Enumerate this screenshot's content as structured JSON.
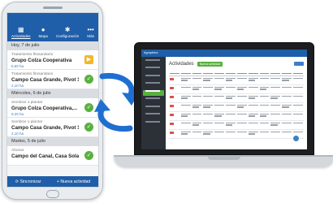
{
  "phone": {
    "nav": [
      {
        "label": "Actividades",
        "icon": "calendar-icon",
        "glyph": "▦",
        "active": true
      },
      {
        "label": "Mapa",
        "icon": "map-pin-icon",
        "glyph": "●",
        "active": false
      },
      {
        "label": "Configuración",
        "icon": "gear-icon",
        "glyph": "✱",
        "active": false
      },
      {
        "label": "Más",
        "icon": "more-icon",
        "glyph": "•••",
        "active": false
      }
    ],
    "days": [
      {
        "header": "Hoy, 7 de julio",
        "tasks": [
          {
            "type": "Tratamiento fitosanitario",
            "place": "Grupo Colza Cooperativa",
            "meta": "5,60 ha",
            "status": "play",
            "status_icon": "play-icon",
            "glyph": "▶"
          },
          {
            "type": "Tratamiento fitosanitario",
            "place": "Campo Casa Grande, Pivot 1",
            "meta": "2,10 ha",
            "status": "done",
            "status_icon": "check-icon",
            "glyph": "✓"
          }
        ]
      },
      {
        "header": "Miércoles, 6 de julio",
        "tasks": [
          {
            "type": "Sembrar o plantar",
            "place": "Grupo Colza Cooperativa,...",
            "meta": "9,20 ha",
            "status": "done",
            "status_icon": "check-icon",
            "glyph": "✓"
          },
          {
            "type": "Sembrar o plantar",
            "place": "Campo Casa Grande, Pivot 1",
            "meta": "2,10 ha",
            "status": "done",
            "status_icon": "check-icon",
            "glyph": "✓"
          }
        ]
      },
      {
        "header": "Martes, 5 de julio",
        "tasks": [
          {
            "type": "Abonar",
            "place": "Campo del Canal, Casa Solana",
            "meta": "",
            "status": "done",
            "status_icon": "check-icon",
            "glyph": "✓"
          }
        ]
      }
    ],
    "footer": {
      "sync": "Sincronizar",
      "new_activity": "+ Nueva actividad"
    }
  },
  "web": {
    "brand": "Agroptima",
    "title": "Actividades",
    "new_button": "Nueva actividad"
  },
  "colors": {
    "primary": "#1f5ea8",
    "accent_green": "#58b13f",
    "accent_yellow": "#f1b82d",
    "sidebar_dark": "#2c3138"
  }
}
